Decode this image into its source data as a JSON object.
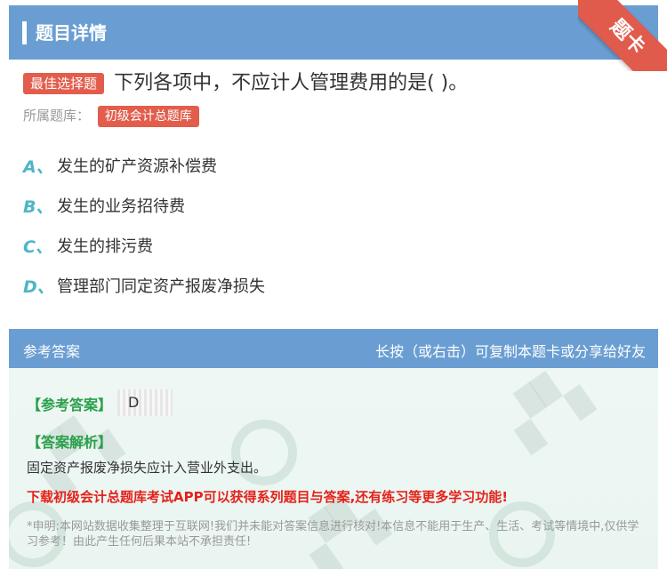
{
  "header": {
    "title": "题目详情",
    "ribbon": "题卡"
  },
  "question": {
    "type_badge": "最佳选择题",
    "text": "下列各项中，不应计人管理费用的是( )。",
    "bank_label": "所属题库：",
    "bank_name": "初级会计总题库"
  },
  "options": [
    {
      "letter": "A、",
      "text": "发生的矿产资源补偿费"
    },
    {
      "letter": "B、",
      "text": "发生的业务招待费"
    },
    {
      "letter": "C、",
      "text": "发生的排污费"
    },
    {
      "letter": "D、",
      "text": "管理部门同定资产报废净损失"
    }
  ],
  "answer": {
    "header_left": "参考答案",
    "header_right": "长按（或右击）可复制本题卡或分享给好友",
    "ref_label": "【参考答案】",
    "ref_value": "D",
    "analysis_label": "【答案解析】",
    "analysis_text": "固定资产报废净损失应计入营业外支出。",
    "promo": "下载初级会计总题库考试APP可以获得系列题目与答案,还有练习等更多学习功能!",
    "disclaimer": "*申明:本网站数据收集整理于互联网!我们并未能对答案信息进行核对!本信息不能用于生产、生活、考试等情境中,仅供学习参考！由此产生任何后果本站不承担责任!"
  },
  "colors": {
    "header_bg": "#6a9ed2",
    "badge_red": "#e25d4c",
    "option_letter": "#4db6c5",
    "answer_green": "#2aa04a",
    "promo_red": "#e4221b"
  }
}
